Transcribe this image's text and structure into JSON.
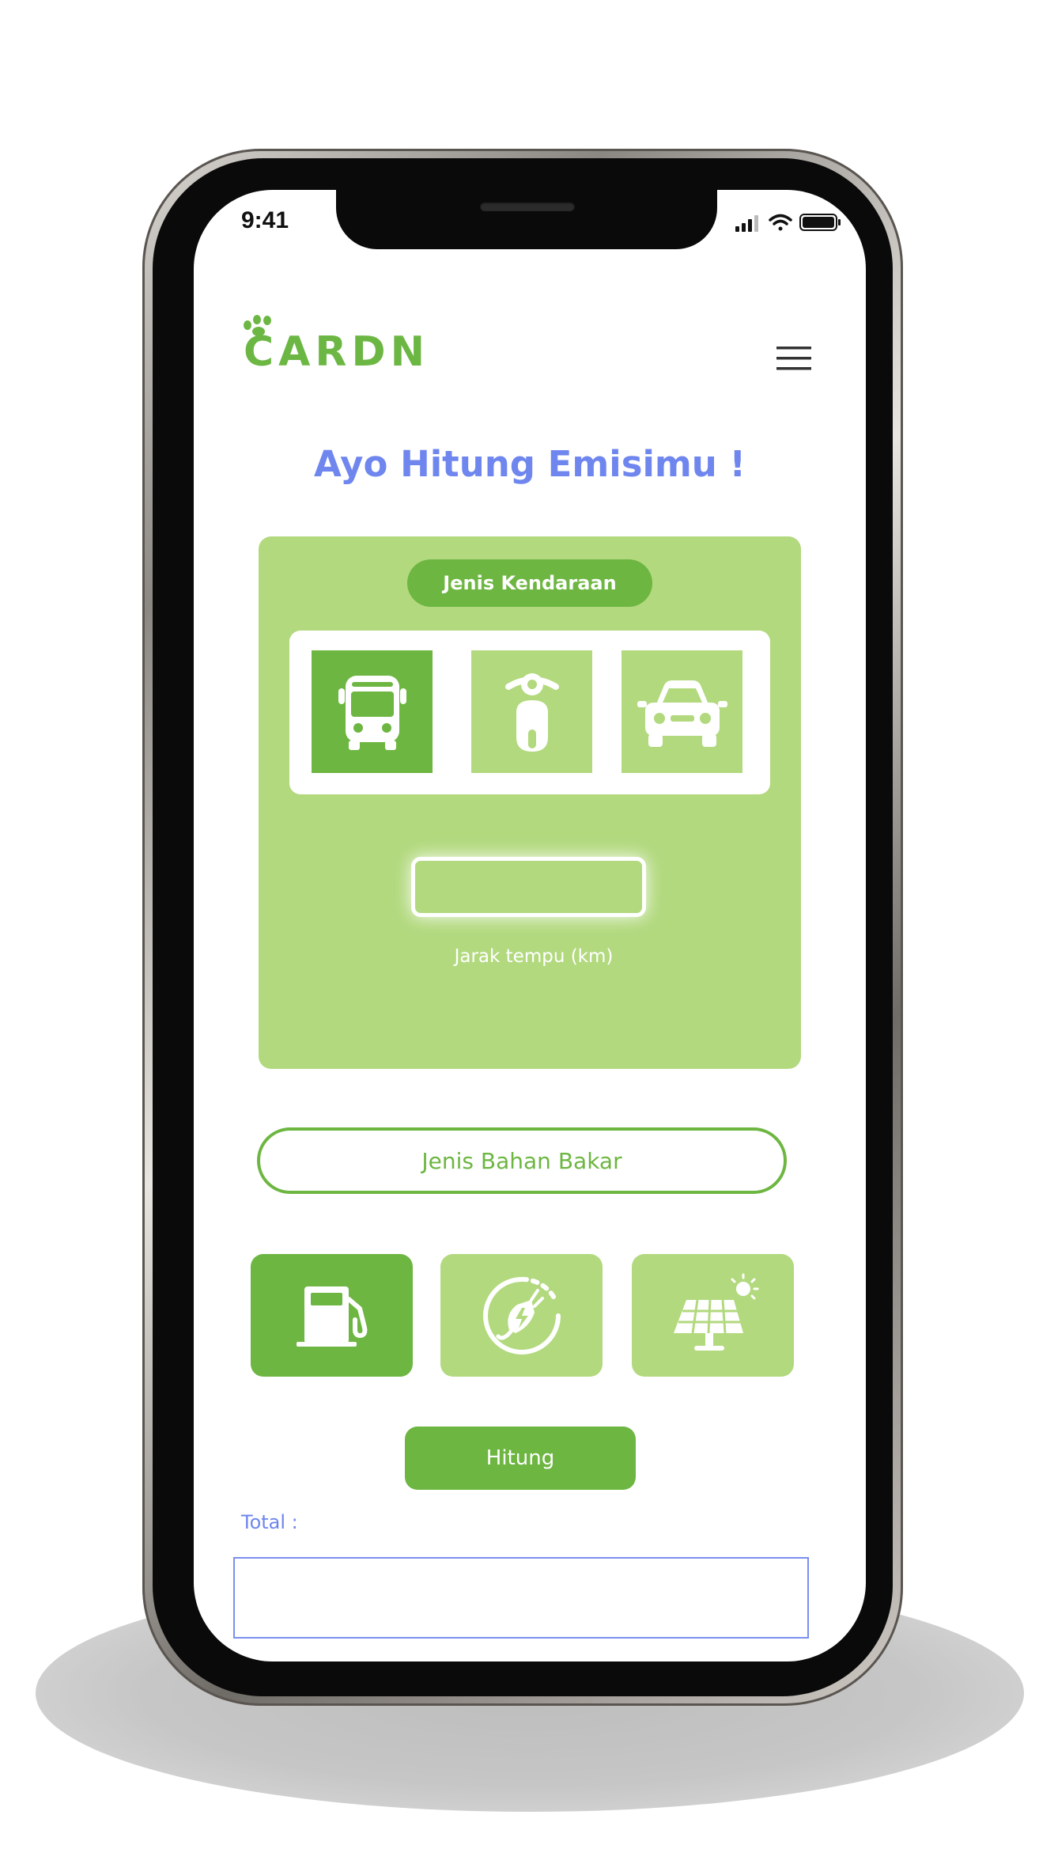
{
  "status_bar": {
    "time": "9:41"
  },
  "header": {
    "logo_text": "CARDN",
    "menu_icon": "hamburger-menu-icon"
  },
  "main": {
    "title": "Ayo Hitung Emisimu !",
    "vehicle_section": {
      "label": "Jenis  Kendaraan",
      "options": [
        {
          "icon": "bus-icon",
          "selected": true
        },
        {
          "icon": "scooter-icon",
          "selected": false
        },
        {
          "icon": "car-icon",
          "selected": false
        }
      ],
      "distance_value": "",
      "distance_label": "Jarak tempu (km)"
    },
    "fuel_section": {
      "label": "Jenis  Bahan Bakar",
      "options": [
        {
          "icon": "fuel-pump-icon",
          "selected": true
        },
        {
          "icon": "electric-plug-icon",
          "selected": false
        },
        {
          "icon": "solar-panel-icon",
          "selected": false
        }
      ]
    },
    "calculate_label": "Hitung",
    "total_label": "Total :",
    "total_value": ""
  },
  "colors": {
    "accent_green": "#6db641",
    "light_green": "#b2d97e",
    "title_blue": "#6e86ee"
  }
}
